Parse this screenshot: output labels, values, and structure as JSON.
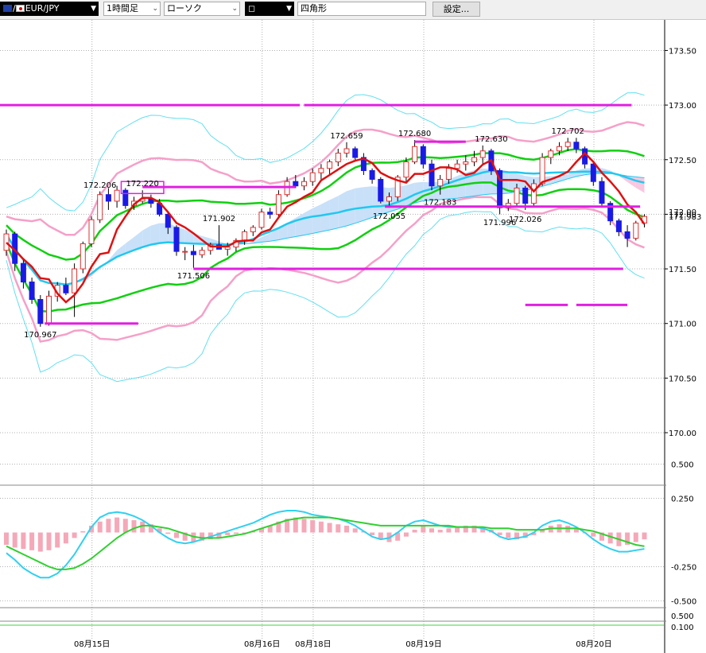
{
  "toolbar": {
    "symbol": "EUR/JPY",
    "symbol_prefix": "/",
    "period": "1時間足",
    "chart_type": "ローソク",
    "color_label": "◻",
    "shape": "四角形",
    "settings_label": "設定..."
  },
  "colors": {
    "up_candle": "#e03030",
    "down_candle": "#1a1ae6",
    "conversion_line": "#e01010",
    "ma_short": "#20c8f0",
    "ma_mid": "#10d010",
    "bollinger_inner": "#f5a0c8",
    "bollinger_outer": "#60e0f0",
    "cloud_fill_bull": "#c8e0f8",
    "cloud_fill_bear": "#f8c8e0",
    "drawing_lines": "#e020e0",
    "macd_hist": "#f5a8b8",
    "macd_line": "#30d0f0",
    "signal_line": "#30d030",
    "grid": "#b0b0b0"
  },
  "chart_data": {
    "type": "candlestick",
    "symbol": "EUR/JPY",
    "timeframe": "1時間足",
    "price_axis": {
      "ticks": [
        "173.50",
        "173.00",
        "172.50",
        "172.00",
        "171.50",
        "171.00",
        "170.50",
        "170.00"
      ],
      "tick_values": [
        173.5,
        173.0,
        172.5,
        172.0,
        171.5,
        171.0,
        170.5,
        170.0
      ],
      "range": [
        169.92,
        173.78
      ],
      "current_price_labels": [
        "172.00",
        "171.983"
      ]
    },
    "date_axis": {
      "labels": [
        "08月15日",
        "08月16日",
        "08月18日",
        "08月19日",
        "08月20日"
      ],
      "label_positions_candle_index": [
        11,
        31,
        37,
        50,
        70
      ]
    },
    "high_low_labels": [
      {
        "text": "170.967",
        "value": 170.967,
        "index": 4
      },
      {
        "text": "172.206",
        "value": 172.206,
        "index": 11
      },
      {
        "text": "172.220",
        "value": 172.22,
        "index": 16
      },
      {
        "text": "171.506",
        "value": 171.506,
        "index": 22
      },
      {
        "text": "171.902",
        "value": 171.902,
        "index": 25
      },
      {
        "text": "172.659",
        "value": 172.659,
        "index": 40
      },
      {
        "text": "172.680",
        "value": 172.68,
        "index": 48
      },
      {
        "text": "172.055",
        "value": 172.055,
        "index": 45
      },
      {
        "text": "172.183",
        "value": 172.183,
        "index": 51
      },
      {
        "text": "172.630",
        "value": 172.63,
        "index": 57
      },
      {
        "text": "171.996",
        "value": 171.996,
        "index": 58
      },
      {
        "text": "172.026",
        "value": 172.026,
        "index": 61
      },
      {
        "text": "172.702",
        "value": 172.702,
        "index": 66
      }
    ],
    "horizontal_lines": [
      {
        "value": 173.0,
        "from": -2,
        "to": 34.5
      },
      {
        "value": 173.0,
        "from": 35,
        "to": 73.5
      },
      {
        "value": 172.25,
        "from": 16,
        "to": 34
      },
      {
        "value": 171.5,
        "from": 22,
        "to": 72.5
      },
      {
        "value": 172.665,
        "from": 48,
        "to": 54
      },
      {
        "value": 172.07,
        "from": 44.5,
        "to": 74.5
      },
      {
        "value": 171.0,
        "from": 4.5,
        "to": 15.5
      },
      {
        "value": 171.17,
        "from": 61,
        "to": 66
      },
      {
        "value": 171.17,
        "from": 67,
        "to": 73
      }
    ],
    "rectangle": {
      "from": 13.5,
      "to": 18.5,
      "top": 172.3,
      "bottom": 172.19
    },
    "candles": [
      [
        171.67,
        171.86,
        171.62,
        171.82
      ],
      [
        171.82,
        171.84,
        171.48,
        171.55
      ],
      [
        171.55,
        171.58,
        171.32,
        171.38
      ],
      [
        171.38,
        171.42,
        171.18,
        171.22
      ],
      [
        171.22,
        171.26,
        170.97,
        171.0
      ],
      [
        171.0,
        171.3,
        170.98,
        171.25
      ],
      [
        171.25,
        171.38,
        171.2,
        171.35
      ],
      [
        171.35,
        171.42,
        171.26,
        171.28
      ],
      [
        171.28,
        171.55,
        171.06,
        171.5
      ],
      [
        171.5,
        171.75,
        171.46,
        171.73
      ],
      [
        171.73,
        171.98,
        171.7,
        171.95
      ],
      [
        171.95,
        172.21,
        171.92,
        172.18
      ],
      [
        172.18,
        172.24,
        172.04,
        172.12
      ],
      [
        172.12,
        172.26,
        172.06,
        172.22
      ],
      [
        172.22,
        172.24,
        172.05,
        172.08
      ],
      [
        172.08,
        172.16,
        172.04,
        172.12
      ],
      [
        172.12,
        172.22,
        172.1,
        172.14
      ],
      [
        172.14,
        172.18,
        172.06,
        172.1
      ],
      [
        172.1,
        172.14,
        171.98,
        172.0
      ],
      [
        172.0,
        172.02,
        171.82,
        171.88
      ],
      [
        171.88,
        171.9,
        171.62,
        171.66
      ],
      [
        171.66,
        171.7,
        171.58,
        171.66
      ],
      [
        171.66,
        171.72,
        171.51,
        171.63
      ],
      [
        171.63,
        171.7,
        171.6,
        171.67
      ],
      [
        171.67,
        171.74,
        171.63,
        171.72
      ],
      [
        171.72,
        171.9,
        171.68,
        171.68
      ],
      [
        171.68,
        171.74,
        171.62,
        171.7
      ],
      [
        171.7,
        171.78,
        171.66,
        171.76
      ],
      [
        171.76,
        171.86,
        171.72,
        171.84
      ],
      [
        171.84,
        171.9,
        171.8,
        171.88
      ],
      [
        171.88,
        172.05,
        171.86,
        172.02
      ],
      [
        172.02,
        172.06,
        171.96,
        172.0
      ],
      [
        172.0,
        172.22,
        171.98,
        172.18
      ],
      [
        172.18,
        172.34,
        172.16,
        172.3
      ],
      [
        172.3,
        172.36,
        172.24,
        172.26
      ],
      [
        172.26,
        172.34,
        172.22,
        172.3
      ],
      [
        172.3,
        172.42,
        172.26,
        172.38
      ],
      [
        172.38,
        172.46,
        172.32,
        172.42
      ],
      [
        172.42,
        172.5,
        172.36,
        172.48
      ],
      [
        172.48,
        172.6,
        172.44,
        172.56
      ],
      [
        172.56,
        172.66,
        172.52,
        172.6
      ],
      [
        172.6,
        172.62,
        172.48,
        172.52
      ],
      [
        172.52,
        172.56,
        172.36,
        172.4
      ],
      [
        172.4,
        172.42,
        172.28,
        172.32
      ],
      [
        172.32,
        172.34,
        172.1,
        172.12
      ],
      [
        172.12,
        172.2,
        172.06,
        172.16
      ],
      [
        172.16,
        172.36,
        172.12,
        172.34
      ],
      [
        172.34,
        172.52,
        172.3,
        172.48
      ],
      [
        172.48,
        172.68,
        172.46,
        172.62
      ],
      [
        172.62,
        172.64,
        172.42,
        172.46
      ],
      [
        172.46,
        172.5,
        172.22,
        172.26
      ],
      [
        172.26,
        172.36,
        172.18,
        172.32
      ],
      [
        172.32,
        172.46,
        172.28,
        172.42
      ],
      [
        172.42,
        172.5,
        172.38,
        172.46
      ],
      [
        172.46,
        172.54,
        172.4,
        172.48
      ],
      [
        172.48,
        172.58,
        172.44,
        172.52
      ],
      [
        172.52,
        172.63,
        172.46,
        172.58
      ],
      [
        172.58,
        172.6,
        172.36,
        172.4
      ],
      [
        172.4,
        172.42,
        172.0,
        172.06
      ],
      [
        172.06,
        172.14,
        172.03,
        172.1
      ],
      [
        172.1,
        172.28,
        172.08,
        172.24
      ],
      [
        172.24,
        172.26,
        172.04,
        172.1
      ],
      [
        172.1,
        172.32,
        172.08,
        172.28
      ],
      [
        172.28,
        172.56,
        172.26,
        172.52
      ],
      [
        172.52,
        172.6,
        172.46,
        172.58
      ],
      [
        172.58,
        172.66,
        172.54,
        172.62
      ],
      [
        172.62,
        172.7,
        172.58,
        172.66
      ],
      [
        172.66,
        172.7,
        172.56,
        172.6
      ],
      [
        172.6,
        172.62,
        172.42,
        172.46
      ],
      [
        172.46,
        172.48,
        172.26,
        172.3
      ],
      [
        172.3,
        172.34,
        172.06,
        172.1
      ],
      [
        172.1,
        172.12,
        171.9,
        171.94
      ],
      [
        171.94,
        171.96,
        171.8,
        171.84
      ],
      [
        171.84,
        171.9,
        171.7,
        171.78
      ],
      [
        171.78,
        171.94,
        171.76,
        171.92
      ],
      [
        171.92,
        172.0,
        171.88,
        171.98
      ]
    ],
    "sub_panel": {
      "type": "macd",
      "axis_ticks": [
        "0.500",
        "0.250",
        "-0.250",
        "-0.500"
      ],
      "tick_values": [
        0.5,
        0.25,
        -0.25,
        -0.5
      ],
      "range": [
        -0.55,
        0.55
      ],
      "histogram": [
        -0.09,
        -0.11,
        -0.12,
        -0.13,
        -0.14,
        -0.13,
        -0.11,
        -0.08,
        -0.04,
        0.01,
        0.05,
        0.08,
        0.1,
        0.11,
        0.1,
        0.09,
        0.08,
        0.06,
        0.03,
        -0.01,
        -0.04,
        -0.06,
        -0.07,
        -0.06,
        -0.05,
        -0.04,
        -0.02,
        -0.01,
        0.0,
        0.01,
        0.03,
        0.05,
        0.08,
        0.1,
        0.11,
        0.1,
        0.09,
        0.08,
        0.07,
        0.06,
        0.05,
        0.03,
        0.01,
        -0.02,
        -0.05,
        -0.07,
        -0.06,
        -0.03,
        0.02,
        0.05,
        0.03,
        0.02,
        0.03,
        0.04,
        0.05,
        0.05,
        0.04,
        0.02,
        -0.02,
        -0.04,
        -0.05,
        -0.04,
        -0.02,
        0.02,
        0.05,
        0.06,
        0.05,
        0.03,
        0.0,
        -0.03,
        -0.06,
        -0.08,
        -0.1,
        -0.09,
        -0.07,
        -0.05
      ],
      "macd_line": [
        -0.15,
        -0.2,
        -0.26,
        -0.3,
        -0.33,
        -0.33,
        -0.3,
        -0.24,
        -0.16,
        -0.06,
        0.04,
        0.11,
        0.14,
        0.15,
        0.14,
        0.12,
        0.09,
        0.05,
        0.0,
        -0.04,
        -0.07,
        -0.08,
        -0.07,
        -0.05,
        -0.03,
        -0.01,
        0.01,
        0.03,
        0.05,
        0.07,
        0.1,
        0.13,
        0.15,
        0.16,
        0.16,
        0.15,
        0.13,
        0.12,
        0.11,
        0.1,
        0.08,
        0.05,
        0.01,
        -0.03,
        -0.05,
        -0.04,
        0.0,
        0.05,
        0.08,
        0.09,
        0.07,
        0.05,
        0.04,
        0.04,
        0.04,
        0.04,
        0.03,
        0.01,
        -0.03,
        -0.05,
        -0.04,
        -0.03,
        0.0,
        0.05,
        0.08,
        0.09,
        0.07,
        0.04,
        0.0,
        -0.05,
        -0.09,
        -0.12,
        -0.14,
        -0.14,
        -0.13,
        -0.12
      ],
      "signal_line": [
        -0.1,
        -0.13,
        -0.16,
        -0.19,
        -0.22,
        -0.25,
        -0.27,
        -0.27,
        -0.26,
        -0.23,
        -0.19,
        -0.14,
        -0.09,
        -0.04,
        0.0,
        0.03,
        0.05,
        0.05,
        0.04,
        0.03,
        0.01,
        -0.01,
        -0.03,
        -0.04,
        -0.04,
        -0.04,
        -0.03,
        -0.02,
        -0.01,
        0.01,
        0.03,
        0.05,
        0.07,
        0.09,
        0.1,
        0.11,
        0.11,
        0.11,
        0.11,
        0.1,
        0.09,
        0.08,
        0.07,
        0.06,
        0.05,
        0.05,
        0.05,
        0.05,
        0.05,
        0.05,
        0.05,
        0.05,
        0.05,
        0.04,
        0.04,
        0.04,
        0.04,
        0.03,
        0.03,
        0.03,
        0.02,
        0.02,
        0.02,
        0.02,
        0.03,
        0.03,
        0.03,
        0.03,
        0.02,
        0.01,
        -0.01,
        -0.03,
        -0.05,
        -0.07,
        -0.09,
        -0.1
      ]
    },
    "lower_panel": {
      "axis_ticks": [
        "0.500",
        "0.100"
      ]
    }
  }
}
